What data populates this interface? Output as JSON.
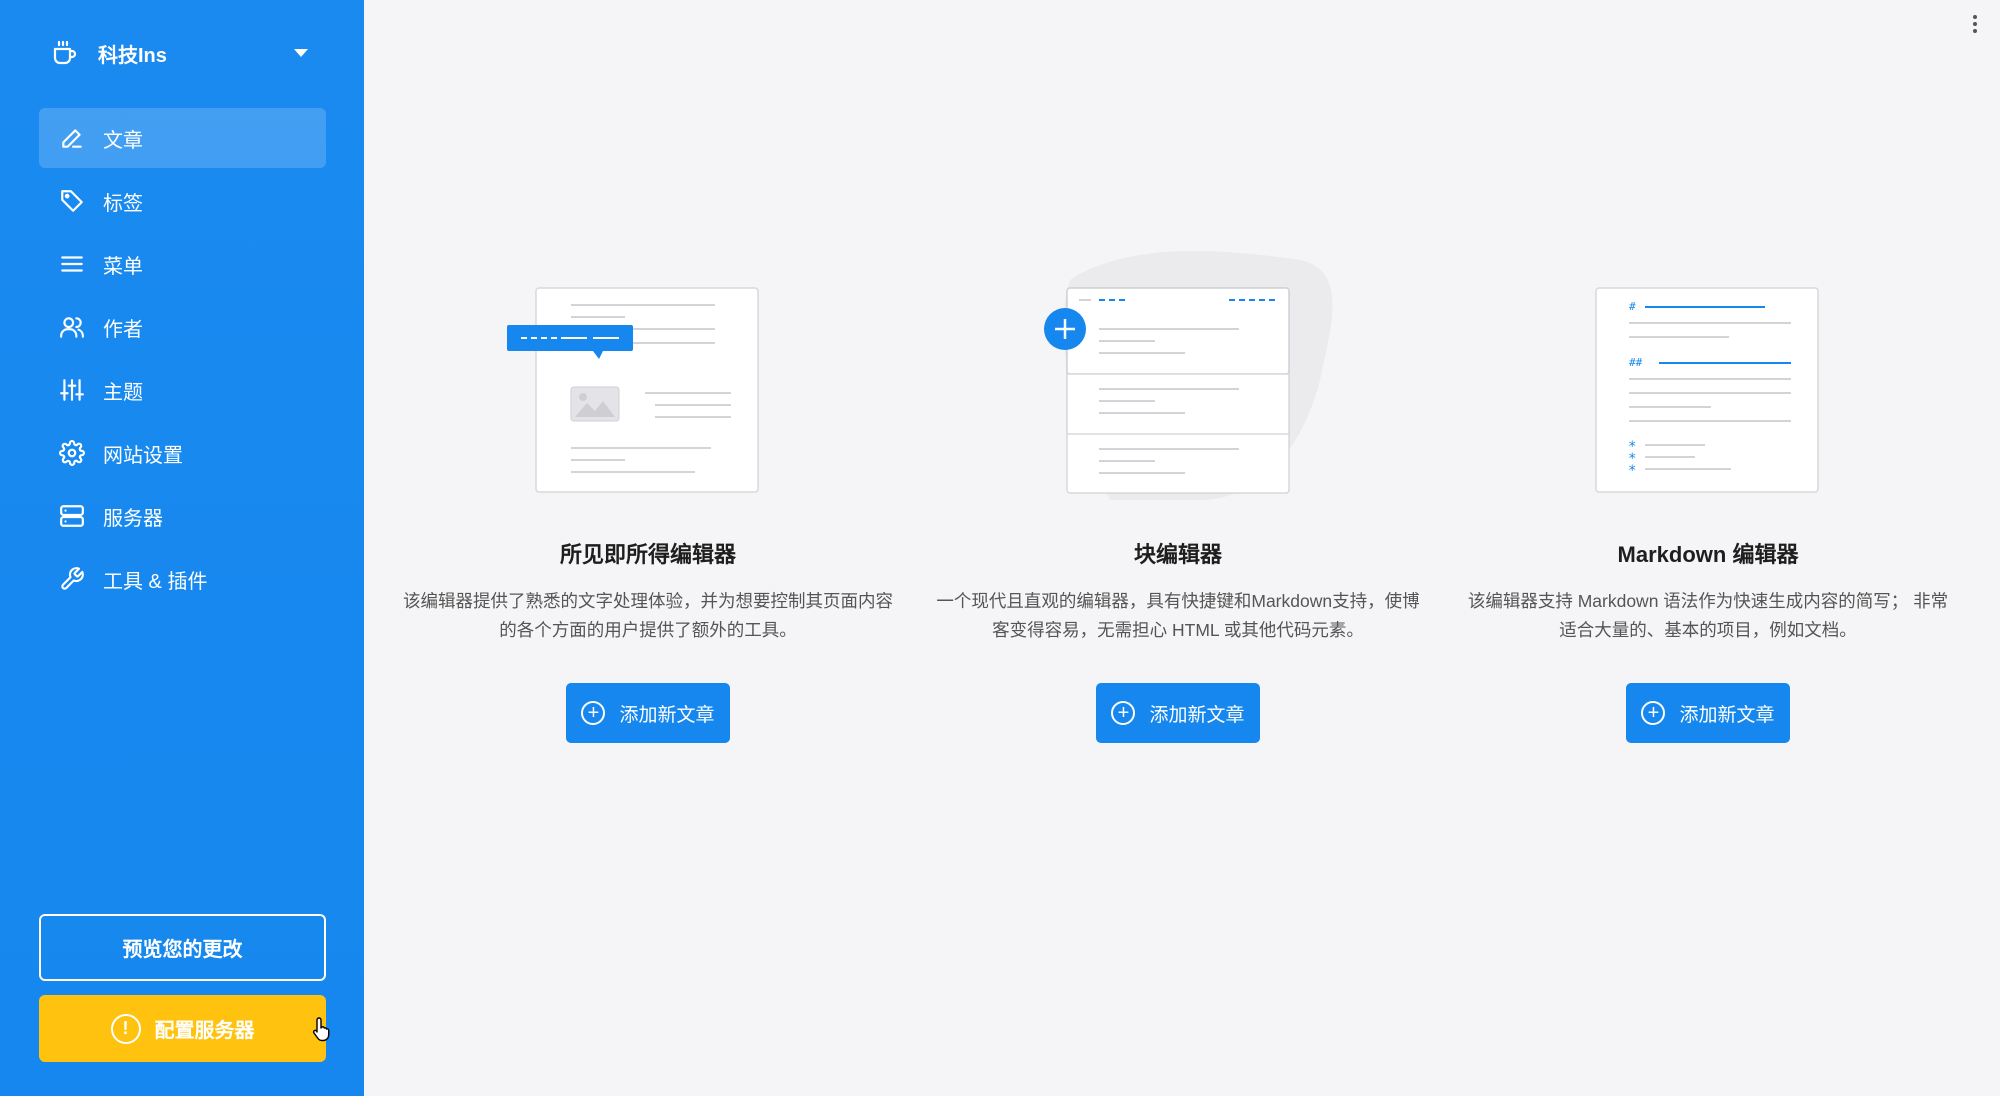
{
  "site": {
    "name": "科技Ins",
    "icon": "coffee-cup-icon"
  },
  "nav": {
    "items": [
      {
        "label": "文章",
        "icon": "pencil-icon",
        "active": true
      },
      {
        "label": "标签",
        "icon": "tag-icon",
        "active": false
      },
      {
        "label": "菜单",
        "icon": "menu-lines-icon",
        "active": false
      },
      {
        "label": "作者",
        "icon": "users-icon",
        "active": false
      },
      {
        "label": "主题",
        "icon": "sliders-icon",
        "active": false
      },
      {
        "label": "网站设置",
        "icon": "gear-icon",
        "active": false
      },
      {
        "label": "服务器",
        "icon": "server-icon",
        "active": false
      },
      {
        "label": "工具 & 插件",
        "icon": "wrench-icon",
        "active": false
      }
    ]
  },
  "actions": {
    "preview_label": "预览您的更改",
    "config_label": "配置服务器",
    "config_icon_glyph": "!"
  },
  "editors": [
    {
      "title": "所见即所得编辑器",
      "description": "该编辑器提供了熟悉的文字处理体验，并为想要控制其页面内容的各个方面的用户提供了额外的工具。",
      "button_label": "添加新文章"
    },
    {
      "title": "块编辑器",
      "description": "一个现代且直观的编辑器，具有快捷键和Markdown支持，使博客变得容易，无需担心 HTML 或其他代码元素。",
      "button_label": "添加新文章"
    },
    {
      "title": "Markdown 编辑器",
      "description": "该编辑器支持 Markdown 语法作为快速生成内容的简写； 非常适合大量的、基本的项目，例如文档。",
      "button_label": "添加新文章"
    }
  ],
  "colors": {
    "sidebar": "#1587ee",
    "accent": "#1587ee",
    "warning": "#ffc20e",
    "background": "#f5f5f7"
  }
}
